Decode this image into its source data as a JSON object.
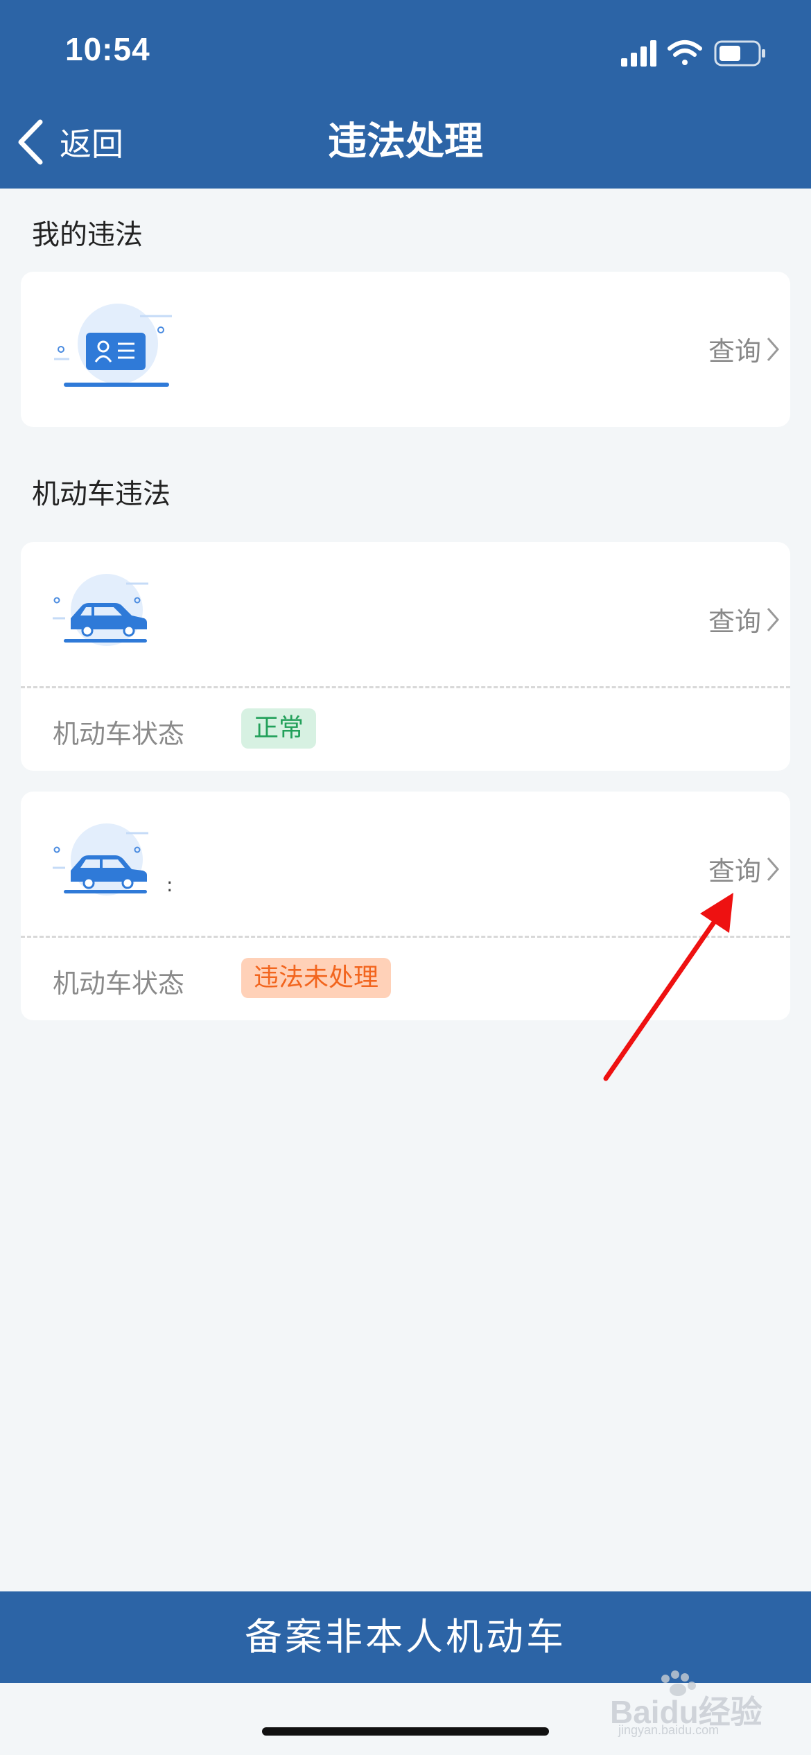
{
  "status_bar": {
    "time": "10:54"
  },
  "nav": {
    "back_label": "返回",
    "title": "违法处理"
  },
  "sections": {
    "my_violations": "我的违法",
    "vehicle_violations": "机动车违法"
  },
  "cards": {
    "license": {
      "query_label": "查询"
    },
    "vehicles": [
      {
        "query_label": "查询",
        "status_label": "机动车状态",
        "status": "正常",
        "extra": ""
      },
      {
        "query_label": "查询",
        "status_label": "机动车状态",
        "status": "违法未处理",
        "extra": ":"
      }
    ]
  },
  "bottom_button": "备案非本人机动车",
  "watermark": {
    "text": "Baidu经验",
    "subtext": "jingyan.baidu.com"
  },
  "colors": {
    "primary": "#2c64a6",
    "normal_badge": "#22a05a",
    "violation_badge": "#f2651e",
    "annotation_arrow": "#ee1111"
  }
}
